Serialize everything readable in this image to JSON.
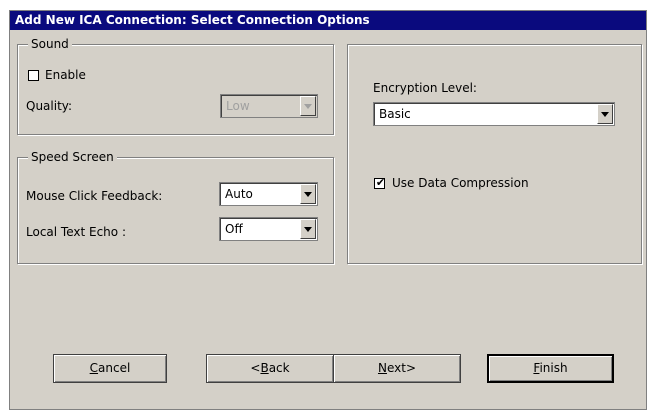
{
  "title": "Add New ICA Connection: Select Connection Options",
  "sound": {
    "legend": "Sound",
    "enable_label": "Enable",
    "enable_checked": false,
    "quality_label": "Quality:",
    "quality_value": "Low"
  },
  "speed_screen": {
    "legend": "Speed Screen",
    "mouse_label": "Mouse Click Feedback:",
    "mouse_value": "Auto",
    "echo_label": "Local Text Echo :",
    "echo_value": "Off"
  },
  "encryption": {
    "label": "Encryption Level:",
    "value": "Basic",
    "compression_label": "Use Data Compression",
    "compression_checked": true
  },
  "buttons": {
    "cancel": {
      "accel": "C",
      "rest": "ancel"
    },
    "back": {
      "pre": "<",
      "accel": "B",
      "rest": "ack"
    },
    "next": {
      "accel": "N",
      "rest": "ext>"
    },
    "finish": {
      "accel": "F",
      "rest": "inish"
    }
  },
  "icons": {
    "dropdown": "chevron-down-icon",
    "check": "checkmark-icon"
  }
}
